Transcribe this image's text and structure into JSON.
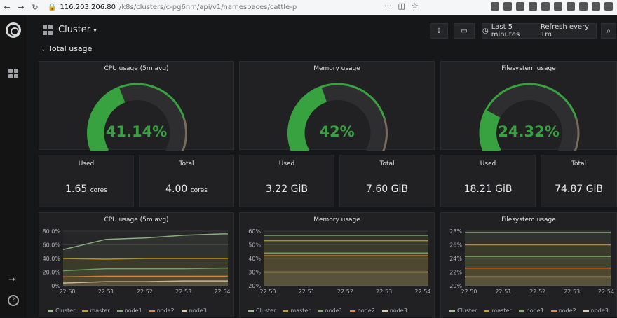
{
  "browser": {
    "back": "←",
    "forward": "→",
    "reload": "↻",
    "url_host": "116.203.206.80",
    "url_path": "/k8s/clusters/c-pg6nm/api/v1/namespaces/cattle-p",
    "dots": "···"
  },
  "dashboard": {
    "title": "Cluster",
    "time_range": "Last 5 minutes",
    "refresh": "Refresh every 1m",
    "row_title": "Total usage"
  },
  "gauges": [
    {
      "title": "CPU usage (5m avg)",
      "value": 0.4114,
      "label": "41.14%"
    },
    {
      "title": "Memory usage",
      "value": 0.42,
      "label": "42%"
    },
    {
      "title": "Filesystem usage",
      "value": 0.2432,
      "label": "24.32%"
    }
  ],
  "stats": [
    {
      "title": "Used",
      "value": "1.65",
      "unit": "cores"
    },
    {
      "title": "Total",
      "value": "4.00",
      "unit": "cores"
    },
    {
      "title": "Used",
      "value": "3.22 GiB",
      "unit": ""
    },
    {
      "title": "Total",
      "value": "7.60 GiB",
      "unit": ""
    },
    {
      "title": "Used",
      "value": "18.21 GiB",
      "unit": ""
    },
    {
      "title": "Total",
      "value": "74.87 GiB",
      "unit": ""
    }
  ],
  "legend_items": [
    "Cluster",
    "master",
    "node1",
    "node2",
    "node3"
  ],
  "colors": {
    "accent": "#37a23f",
    "gauge_track": "#2e2e30",
    "gauge_thresh": "#7a6a5a",
    "cluster": "#9ac48a",
    "master": "#cca300",
    "node1": "#7eb26d",
    "node2": "#ef843c",
    "node3": "#e0c9a3"
  },
  "chart_data": [
    {
      "type": "area",
      "title": "CPU usage (5m avg)",
      "x": [
        "22:50",
        "22:51",
        "22:52",
        "22:53",
        "22:54"
      ],
      "ylim": [
        0,
        80
      ],
      "yticks": [
        "0%",
        "20.0%",
        "40.0%",
        "60.0%",
        "80.0%"
      ],
      "series": [
        {
          "name": "Cluster",
          "values": [
            53,
            68,
            70,
            74,
            76
          ]
        },
        {
          "name": "master",
          "values": [
            40,
            39,
            40,
            40,
            40
          ]
        },
        {
          "name": "node1",
          "values": [
            22,
            25,
            25,
            25,
            26
          ]
        },
        {
          "name": "node2",
          "values": [
            13,
            14,
            14,
            14,
            14
          ]
        },
        {
          "name": "node3",
          "values": [
            4,
            6,
            6,
            7,
            7
          ]
        }
      ]
    },
    {
      "type": "area",
      "title": "Memory usage",
      "x": [
        "22:50",
        "22:51",
        "22:52",
        "22:53",
        "22:54"
      ],
      "ylim": [
        20,
        60
      ],
      "yticks": [
        "20%",
        "30%",
        "40%",
        "50%",
        "60%"
      ],
      "series": [
        {
          "name": "Cluster",
          "values": [
            57,
            57,
            57,
            57,
            57
          ]
        },
        {
          "name": "master",
          "values": [
            53,
            53,
            53,
            53,
            53
          ]
        },
        {
          "name": "node1",
          "values": [
            44,
            44,
            44,
            44,
            44
          ]
        },
        {
          "name": "node2",
          "values": [
            42,
            42,
            42,
            42,
            42
          ]
        },
        {
          "name": "node3",
          "values": [
            30,
            30,
            30,
            30,
            30
          ]
        }
      ]
    },
    {
      "type": "area",
      "title": "Filesystem usage",
      "x": [
        "22:50",
        "22:51",
        "22:52",
        "22:53",
        "22:54"
      ],
      "ylim": [
        20,
        28
      ],
      "yticks": [
        "20%",
        "22%",
        "24%",
        "26%",
        "28%"
      ],
      "series": [
        {
          "name": "Cluster",
          "values": [
            27.8,
            27.8,
            27.8,
            27.8,
            27.8
          ]
        },
        {
          "name": "master",
          "values": [
            26,
            26,
            26,
            26,
            26
          ]
        },
        {
          "name": "node1",
          "values": [
            24.3,
            24.3,
            24.3,
            24.3,
            24.3
          ]
        },
        {
          "name": "node2",
          "values": [
            22.6,
            22.6,
            22.6,
            22.6,
            22.6
          ]
        },
        {
          "name": "node3",
          "values": [
            21.3,
            21.3,
            21.3,
            21.3,
            21.3
          ]
        }
      ]
    }
  ]
}
